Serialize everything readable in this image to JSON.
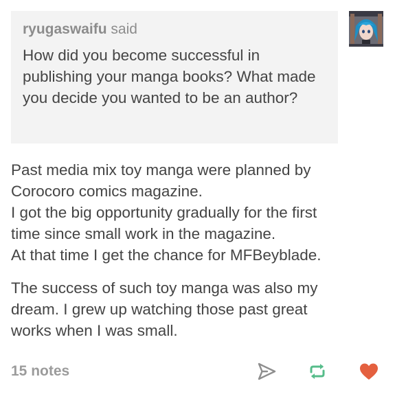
{
  "ask": {
    "asker": "ryugaswaifu",
    "said": "said",
    "question": "How did you become successful in publishing your manga books? What made you decide you wanted to be an author?"
  },
  "answer": {
    "paragraph1": [
      "Past media mix toy manga were planned by",
      "Corocoro comics magazine.",
      "I got the big opportunity gradually for the first",
      "time since small work in the magazine.",
      "At that time I get the chance for MFBeyblade."
    ],
    "paragraph2": [
      "The success of such toy manga was also my",
      "dream. I grew up watching those past great",
      "works when I was small."
    ]
  },
  "footer": {
    "notes": "15 notes",
    "icons": {
      "share": "share-paper-plane-icon",
      "reblog": "reblog-icon",
      "like": "heart-icon"
    }
  },
  "colors": {
    "ask_background": "#f3f3f3",
    "text": "#444444",
    "muted": "#8c8c8c",
    "reblog_green": "#56bc8a",
    "heart_red": "#e4603f"
  }
}
